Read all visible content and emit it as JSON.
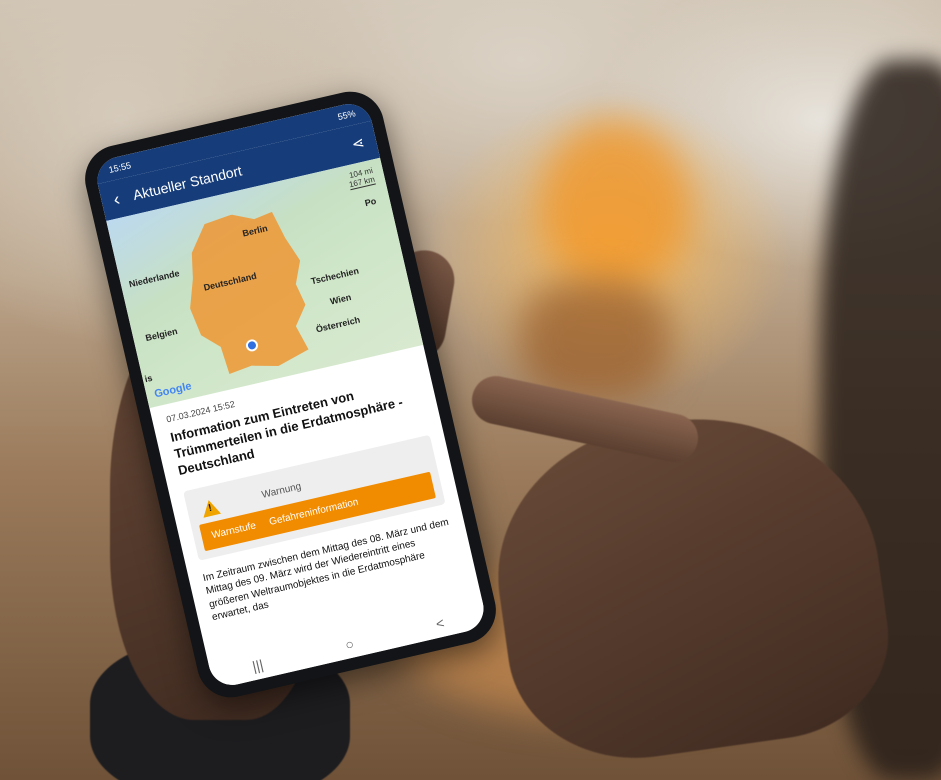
{
  "status_bar": {
    "time": "15:55",
    "indicators": "55%"
  },
  "app_bar": {
    "back_icon": "back-arrow-icon",
    "title": "Aktueller Standort",
    "share_icon": "share-icon"
  },
  "map": {
    "scale_mi": "104 mi",
    "scale_km": "167 km",
    "labels": {
      "niederlande": "Niederlande",
      "berlin": "Berlin",
      "deutschland": "Deutschland",
      "belgien": "Belgien",
      "tschechien": "Tschechien",
      "wien": "Wien",
      "oesterreich": "Österreich",
      "po": "Po",
      "is": "is"
    },
    "provider": "Google",
    "highlight_color": "#f0a040"
  },
  "alert": {
    "date": "07.03.2024 15:52",
    "title": "Information zum Eintreten von Trümmerteilen in die Erdatmosphäre - Deutschland",
    "warning_label": "Warnung",
    "warning_icon": "warning-triangle-icon",
    "level_label": "Warnstufe",
    "level_value": "Gefahreninformation",
    "level_color": "#f18b00",
    "body": "Im Zeitraum zwischen dem Mittag des 08. März und dem Mittag des 09. März wird der Wiedereintritt eines größeren Weltraumobjektes in die Erdatmosphäre erwartet, das"
  },
  "nav": {
    "recent": "|||",
    "home": "○",
    "back": "<"
  }
}
